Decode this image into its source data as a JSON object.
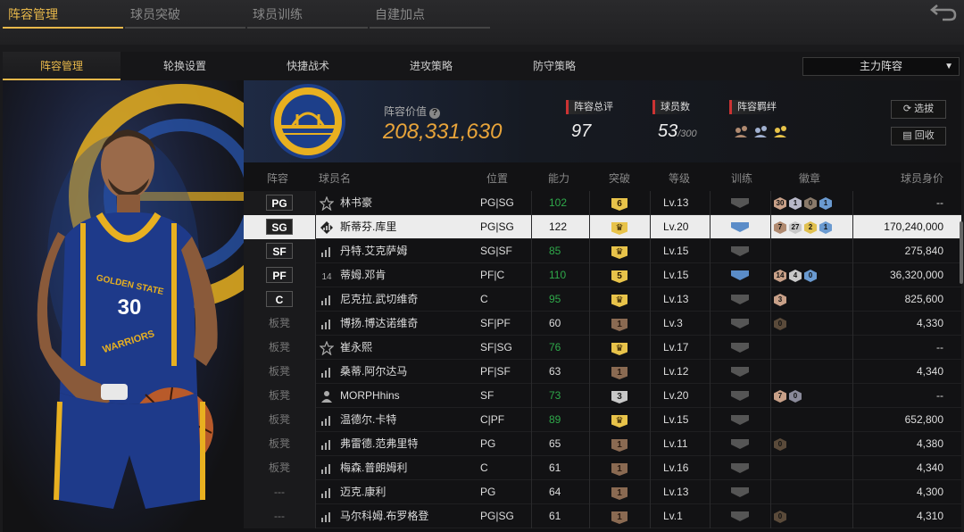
{
  "top_tabs": [
    "阵容管理",
    "球员突破",
    "球员训练",
    "自建加点"
  ],
  "sub_tabs": [
    "阵容管理",
    "轮换设置",
    "快捷战术",
    "进攻策略",
    "防守策略"
  ],
  "lineup_select": "主力阵容",
  "summary": {
    "value_label": "阵容价值",
    "value": "208,331,630",
    "rating_label": "阵容总评",
    "rating": "97",
    "players_label": "球员数",
    "players": "53",
    "players_max": "/300",
    "chemistry_label": "阵容羁绊"
  },
  "buttons": {
    "select": "选拔",
    "recycle": "回收"
  },
  "columns": [
    "阵容",
    "球员名",
    "位置",
    "能力",
    "突破",
    "等级",
    "训练",
    "徽章",
    "球员身价"
  ],
  "rows": [
    {
      "lineup": "PG",
      "icon": "star",
      "name": "林书豪",
      "pos": "PG|SG",
      "ability": "102",
      "ability_green": true,
      "break": "6",
      "break_color": "gold",
      "level": "Lv.13",
      "train": "gray",
      "badges": [
        [
          "30",
          "#c8a088"
        ],
        [
          "1",
          "#b8b8c8"
        ],
        [
          "0",
          "#8a7a6a"
        ],
        [
          "1",
          "#6a9ad0"
        ]
      ],
      "value": "--"
    },
    {
      "lineup": "SG",
      "icon": "diamond",
      "name": "斯蒂芬.库里",
      "pos": "PG|SG",
      "ability": "122",
      "ability_green": false,
      "break": "♛",
      "break_color": "gold",
      "level": "Lv.20",
      "train": "blue",
      "badges": [
        [
          "7",
          "#b08a70"
        ],
        [
          "27",
          "#c8c8c8"
        ],
        [
          "2",
          "#e0c050"
        ],
        [
          "1",
          "#6a9ad0"
        ]
      ],
      "value": "170,240,000",
      "selected": true
    },
    {
      "lineup": "SF",
      "icon": "bars",
      "name": "丹特.艾克萨姆",
      "pos": "SG|SF",
      "ability": "85",
      "ability_green": true,
      "break": "♛",
      "break_color": "gold",
      "level": "Lv.15",
      "train": "gray",
      "badges": [],
      "value": "275,840"
    },
    {
      "lineup": "PF",
      "icon": "14",
      "name": "蒂姆.邓肯",
      "pos": "PF|C",
      "ability": "110",
      "ability_green": true,
      "break": "5",
      "break_color": "gold",
      "level": "Lv.15",
      "train": "blue",
      "badges": [
        [
          "14",
          "#c8a088"
        ],
        [
          "4",
          "#c8c8c8"
        ],
        [
          "0",
          "#6a9ad0"
        ]
      ],
      "value": "36,320,000"
    },
    {
      "lineup": "C",
      "icon": "bars",
      "name": "尼克拉.武切维奇",
      "pos": "C",
      "ability": "95",
      "ability_green": true,
      "break": "♛",
      "break_color": "gold",
      "level": "Lv.13",
      "train": "gray",
      "badges": [
        [
          "3",
          "#c8a088"
        ]
      ],
      "value": "825,600"
    },
    {
      "lineup": "板凳",
      "icon": "bars",
      "name": "博扬.博达诺维奇",
      "pos": "SF|PF",
      "ability": "60",
      "ability_green": false,
      "break": "1",
      "break_color": "brown",
      "level": "Lv.3",
      "train": "gray",
      "badges": [
        [
          "0",
          "#5a4a3a"
        ]
      ],
      "value": "4,330"
    },
    {
      "lineup": "板凳",
      "icon": "star",
      "name": "崔永熙",
      "pos": "SF|SG",
      "ability": "76",
      "ability_green": true,
      "break": "♛",
      "break_color": "gold",
      "level": "Lv.17",
      "train": "gray",
      "badges": [],
      "value": "--"
    },
    {
      "lineup": "板凳",
      "icon": "bars",
      "name": "桑蒂.阿尔达马",
      "pos": "PF|SF",
      "ability": "63",
      "ability_green": false,
      "break": "1",
      "break_color": "brown",
      "level": "Lv.12",
      "train": "gray",
      "badges": [],
      "value": "4,340"
    },
    {
      "lineup": "板凳",
      "icon": "person",
      "name": "MORPHhins",
      "pos": "SF",
      "ability": "73",
      "ability_green": true,
      "break": "3",
      "break_color": "silver",
      "level": "Lv.20",
      "train": "gray",
      "badges": [
        [
          "7",
          "#c8a088"
        ],
        [
          "0",
          "#8a8a9a"
        ]
      ],
      "value": "--"
    },
    {
      "lineup": "板凳",
      "icon": "bars",
      "name": "温德尔.卡特",
      "pos": "C|PF",
      "ability": "89",
      "ability_green": true,
      "break": "♛",
      "break_color": "gold",
      "level": "Lv.15",
      "train": "gray",
      "badges": [],
      "value": "652,800"
    },
    {
      "lineup": "板凳",
      "icon": "bars",
      "name": "弗雷德.范弗里特",
      "pos": "PG",
      "ability": "65",
      "ability_green": false,
      "break": "1",
      "break_color": "brown",
      "level": "Lv.11",
      "train": "gray",
      "badges": [
        [
          "0",
          "#5a4a3a"
        ]
      ],
      "value": "4,380"
    },
    {
      "lineup": "板凳",
      "icon": "bars",
      "name": "梅森.普朗姆利",
      "pos": "C",
      "ability": "61",
      "ability_green": false,
      "break": "1",
      "break_color": "brown",
      "level": "Lv.16",
      "train": "gray",
      "badges": [],
      "value": "4,340"
    },
    {
      "lineup": "---",
      "icon": "bars",
      "name": "迈克.康利",
      "pos": "PG",
      "ability": "64",
      "ability_green": false,
      "break": "1",
      "break_color": "brown",
      "level": "Lv.13",
      "train": "gray",
      "badges": [],
      "value": "4,300"
    },
    {
      "lineup": "---",
      "icon": "bars",
      "name": "马尔科姆.布罗格登",
      "pos": "PG|SG",
      "ability": "61",
      "ability_green": false,
      "break": "1",
      "break_color": "brown",
      "level": "Lv.1",
      "train": "gray",
      "badges": [
        [
          "0",
          "#5a4a3a"
        ]
      ],
      "value": "4,310"
    }
  ],
  "player_art": {
    "team": "GOLDEN STATE",
    "jersey_city": "WARRIORS",
    "number": "30"
  }
}
